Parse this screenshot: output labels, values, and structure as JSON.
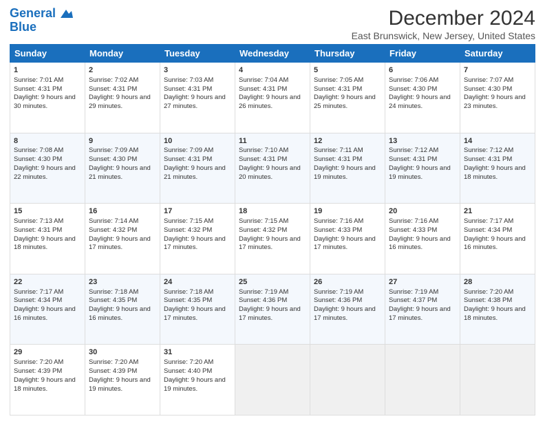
{
  "header": {
    "logo_line1": "General",
    "logo_line2": "Blue",
    "title": "December 2024",
    "subtitle": "East Brunswick, New Jersey, United States"
  },
  "days_of_week": [
    "Sunday",
    "Monday",
    "Tuesday",
    "Wednesday",
    "Thursday",
    "Friday",
    "Saturday"
  ],
  "weeks": [
    [
      {
        "day": "1",
        "info": "Sunrise: 7:01 AM\nSunset: 4:31 PM\nDaylight: 9 hours and 30 minutes."
      },
      {
        "day": "2",
        "info": "Sunrise: 7:02 AM\nSunset: 4:31 PM\nDaylight: 9 hours and 29 minutes."
      },
      {
        "day": "3",
        "info": "Sunrise: 7:03 AM\nSunset: 4:31 PM\nDaylight: 9 hours and 27 minutes."
      },
      {
        "day": "4",
        "info": "Sunrise: 7:04 AM\nSunset: 4:31 PM\nDaylight: 9 hours and 26 minutes."
      },
      {
        "day": "5",
        "info": "Sunrise: 7:05 AM\nSunset: 4:31 PM\nDaylight: 9 hours and 25 minutes."
      },
      {
        "day": "6",
        "info": "Sunrise: 7:06 AM\nSunset: 4:30 PM\nDaylight: 9 hours and 24 minutes."
      },
      {
        "day": "7",
        "info": "Sunrise: 7:07 AM\nSunset: 4:30 PM\nDaylight: 9 hours and 23 minutes."
      }
    ],
    [
      {
        "day": "8",
        "info": "Sunrise: 7:08 AM\nSunset: 4:30 PM\nDaylight: 9 hours and 22 minutes."
      },
      {
        "day": "9",
        "info": "Sunrise: 7:09 AM\nSunset: 4:30 PM\nDaylight: 9 hours and 21 minutes."
      },
      {
        "day": "10",
        "info": "Sunrise: 7:09 AM\nSunset: 4:31 PM\nDaylight: 9 hours and 21 minutes."
      },
      {
        "day": "11",
        "info": "Sunrise: 7:10 AM\nSunset: 4:31 PM\nDaylight: 9 hours and 20 minutes."
      },
      {
        "day": "12",
        "info": "Sunrise: 7:11 AM\nSunset: 4:31 PM\nDaylight: 9 hours and 19 minutes."
      },
      {
        "day": "13",
        "info": "Sunrise: 7:12 AM\nSunset: 4:31 PM\nDaylight: 9 hours and 19 minutes."
      },
      {
        "day": "14",
        "info": "Sunrise: 7:12 AM\nSunset: 4:31 PM\nDaylight: 9 hours and 18 minutes."
      }
    ],
    [
      {
        "day": "15",
        "info": "Sunrise: 7:13 AM\nSunset: 4:31 PM\nDaylight: 9 hours and 18 minutes."
      },
      {
        "day": "16",
        "info": "Sunrise: 7:14 AM\nSunset: 4:32 PM\nDaylight: 9 hours and 17 minutes."
      },
      {
        "day": "17",
        "info": "Sunrise: 7:15 AM\nSunset: 4:32 PM\nDaylight: 9 hours and 17 minutes."
      },
      {
        "day": "18",
        "info": "Sunrise: 7:15 AM\nSunset: 4:32 PM\nDaylight: 9 hours and 17 minutes."
      },
      {
        "day": "19",
        "info": "Sunrise: 7:16 AM\nSunset: 4:33 PM\nDaylight: 9 hours and 17 minutes."
      },
      {
        "day": "20",
        "info": "Sunrise: 7:16 AM\nSunset: 4:33 PM\nDaylight: 9 hours and 16 minutes."
      },
      {
        "day": "21",
        "info": "Sunrise: 7:17 AM\nSunset: 4:34 PM\nDaylight: 9 hours and 16 minutes."
      }
    ],
    [
      {
        "day": "22",
        "info": "Sunrise: 7:17 AM\nSunset: 4:34 PM\nDaylight: 9 hours and 16 minutes."
      },
      {
        "day": "23",
        "info": "Sunrise: 7:18 AM\nSunset: 4:35 PM\nDaylight: 9 hours and 16 minutes."
      },
      {
        "day": "24",
        "info": "Sunrise: 7:18 AM\nSunset: 4:35 PM\nDaylight: 9 hours and 17 minutes."
      },
      {
        "day": "25",
        "info": "Sunrise: 7:19 AM\nSunset: 4:36 PM\nDaylight: 9 hours and 17 minutes."
      },
      {
        "day": "26",
        "info": "Sunrise: 7:19 AM\nSunset: 4:36 PM\nDaylight: 9 hours and 17 minutes."
      },
      {
        "day": "27",
        "info": "Sunrise: 7:19 AM\nSunset: 4:37 PM\nDaylight: 9 hours and 17 minutes."
      },
      {
        "day": "28",
        "info": "Sunrise: 7:20 AM\nSunset: 4:38 PM\nDaylight: 9 hours and 18 minutes."
      }
    ],
    [
      {
        "day": "29",
        "info": "Sunrise: 7:20 AM\nSunset: 4:39 PM\nDaylight: 9 hours and 18 minutes."
      },
      {
        "day": "30",
        "info": "Sunrise: 7:20 AM\nSunset: 4:39 PM\nDaylight: 9 hours and 19 minutes."
      },
      {
        "day": "31",
        "info": "Sunrise: 7:20 AM\nSunset: 4:40 PM\nDaylight: 9 hours and 19 minutes."
      },
      {
        "day": "",
        "info": ""
      },
      {
        "day": "",
        "info": ""
      },
      {
        "day": "",
        "info": ""
      },
      {
        "day": "",
        "info": ""
      }
    ]
  ]
}
